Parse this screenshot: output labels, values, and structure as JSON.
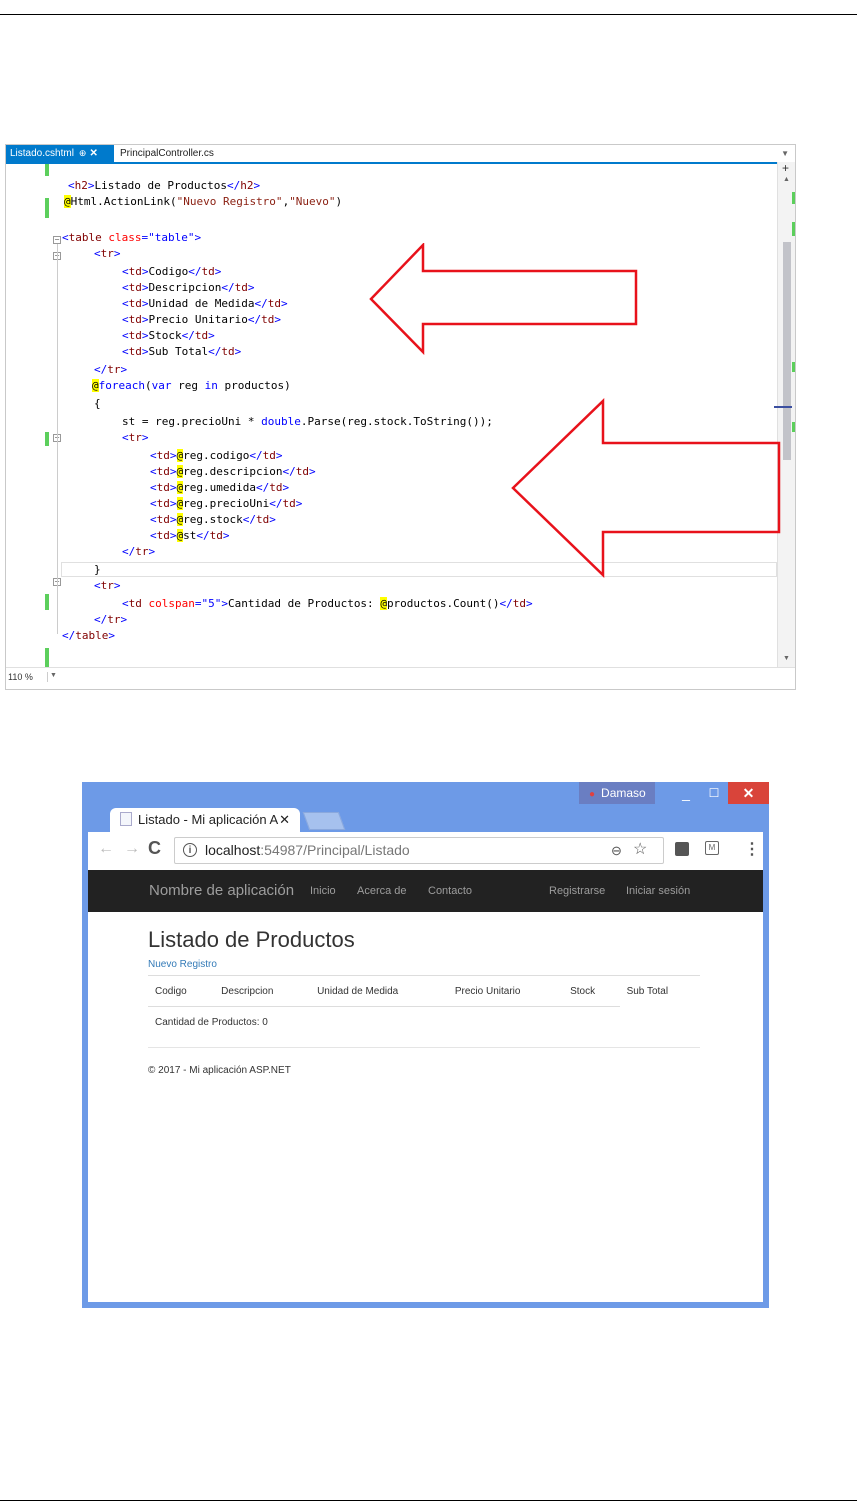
{
  "editor": {
    "tabs": [
      {
        "label": "Listado.cshtml",
        "pin": "⊕",
        "close": "✕"
      },
      {
        "label": "PrincipalController.cs"
      }
    ],
    "zoom": "110 %"
  },
  "browser": {
    "user": "Damaso",
    "tab_title": "Listado - Mi aplicación A",
    "url_host": "localhost",
    "url_path": ":54987/Principal/Listado",
    "navbar": {
      "brand": "Nombre de aplicación",
      "links": [
        "Inicio",
        "Acerca de",
        "Contacto"
      ],
      "right_links": [
        "Registrarse",
        "Iniciar sesión"
      ]
    },
    "page": {
      "heading": "Listado de Productos",
      "new_link": "Nuevo Registro",
      "table_headers": [
        "Codigo",
        "Descripcion",
        "Unidad de Medida",
        "Precio Unitario",
        "Stock",
        "Sub Total"
      ],
      "count_row": "Cantidad de Productos: 0",
      "footer": "© 2017 - Mi aplicación ASP.NET"
    }
  },
  "colors": {
    "vs_accent": "#007acc",
    "arrow_red": "#e8121b",
    "chrome_frame": "#6d9ae7",
    "navbar_bg": "#222222",
    "link_blue": "#337ab7"
  }
}
